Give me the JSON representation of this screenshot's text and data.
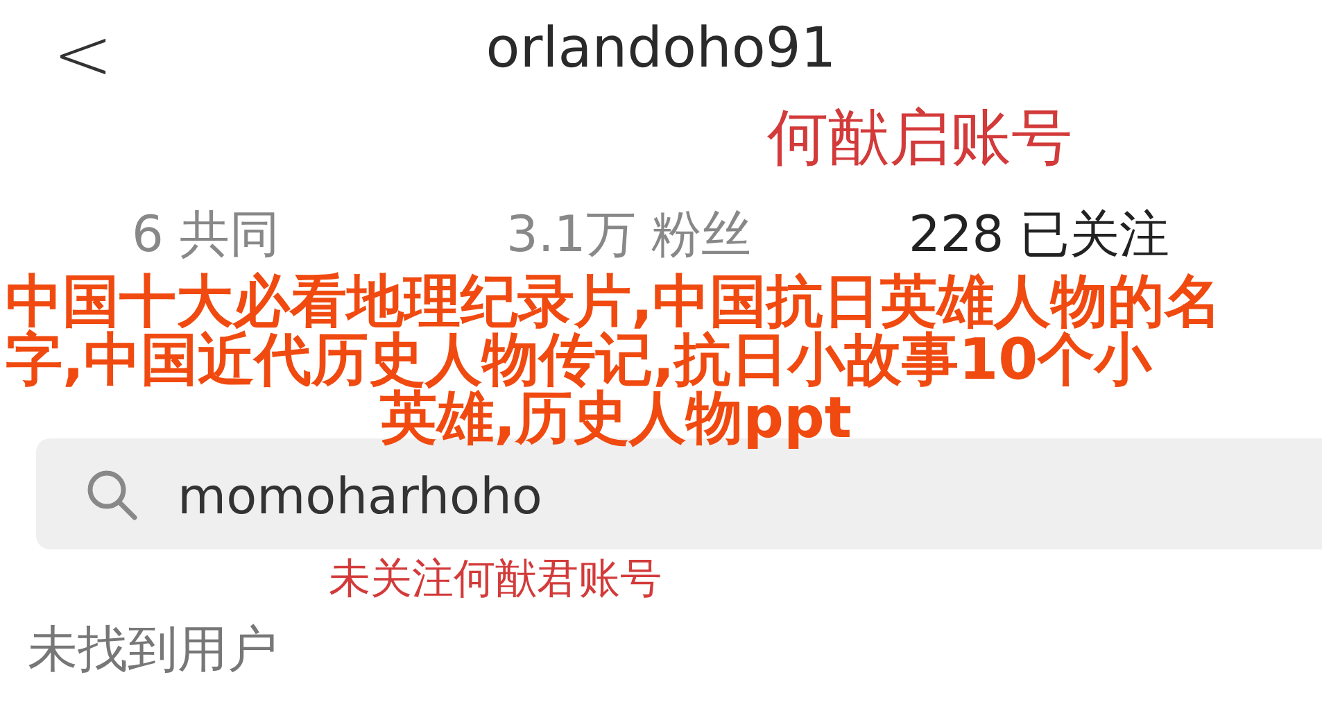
{
  "header": {
    "back": "<",
    "username": "orlandoho91"
  },
  "annotations": [
    {
      "text": "何猷启账号"
    },
    {
      "text": "未关注何猷君账号"
    }
  ],
  "stats": [
    {
      "count": "6",
      "label": "共同",
      "muted": true
    },
    {
      "count": "3.1万",
      "label": "粉丝",
      "muted": true
    },
    {
      "count": "228",
      "label": "已关注",
      "muted": false
    }
  ],
  "overlay_title": [
    "中国十大必看地理纪录片,中国抗日英雄人物的名",
    "字,中国近代历史人物传记,抗日小故事10个小",
    "英雄,历史人物ppt"
  ],
  "search": {
    "value": "momoharhoho"
  },
  "result": "未找到用户"
}
